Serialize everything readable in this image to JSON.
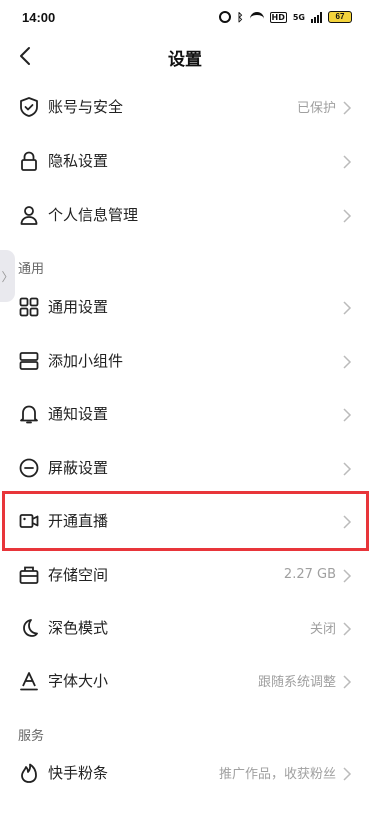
{
  "status_bar": {
    "time": "14:00",
    "bluetooth": "ฎ",
    "hd": "HD",
    "network": "5G",
    "battery": "67"
  },
  "header": {
    "title": "设置"
  },
  "side_tab": {
    "glyph": "〉"
  },
  "items_top": [
    {
      "label": "账号与安全",
      "value": "已保护",
      "icon": "shield-check-icon"
    },
    {
      "label": "隐私设置",
      "value": "",
      "icon": "lock-icon"
    },
    {
      "label": "个人信息管理",
      "value": "",
      "icon": "person-icon"
    }
  ],
  "section_general": {
    "title": "通用"
  },
  "items_general": [
    {
      "label": "通用设置",
      "value": "",
      "icon": "grid-icon"
    },
    {
      "label": "添加小组件",
      "value": "",
      "icon": "widget-icon"
    },
    {
      "label": "通知设置",
      "value": "",
      "icon": "bell-icon"
    },
    {
      "label": "屏蔽设置",
      "value": "",
      "icon": "block-icon"
    },
    {
      "label": "开通直播",
      "value": "",
      "icon": "video-camera-icon"
    },
    {
      "label": "存储空间",
      "value": "2.27 GB",
      "icon": "storage-icon"
    },
    {
      "label": "深色模式",
      "value": "关闭",
      "icon": "moon-icon"
    },
    {
      "label": "字体大小",
      "value": "跟随系统调整",
      "icon": "font-size-icon"
    }
  ],
  "section_services": {
    "title": "服务"
  },
  "items_services": [
    {
      "label": "快手粉条",
      "value": "推广作品，收获粉丝",
      "icon": "fire-icon"
    }
  ]
}
